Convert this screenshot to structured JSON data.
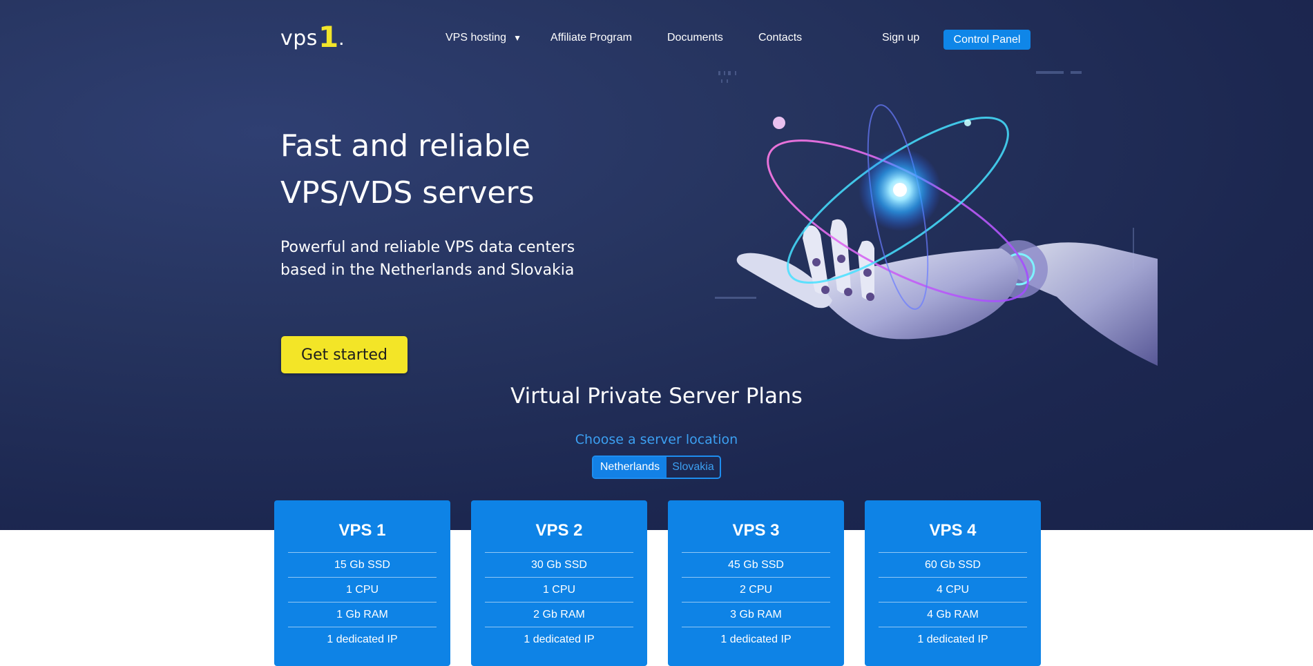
{
  "logo": {
    "text": "vps",
    "number": "1",
    "dot": "."
  },
  "nav": {
    "vps_hosting": "VPS hosting",
    "affiliate": "Affiliate Program",
    "documents": "Documents",
    "contacts": "Contacts",
    "sign_up": "Sign up",
    "control_panel": "Control Panel"
  },
  "hero": {
    "title_line1": "Fast and reliable",
    "title_line2": "VPS/VDS servers",
    "subtitle": "Powerful and reliable VPS data centers based in the Netherlands and Slovakia",
    "cta": "Get started"
  },
  "plans": {
    "title": "Virtual Private Server Plans",
    "location_label": "Choose a server location",
    "locations": [
      "Netherlands",
      "Slovakia"
    ],
    "selected_location": "Netherlands",
    "cards": [
      {
        "name": "VPS 1",
        "specs": [
          "15 Gb SSD",
          "1 CPU",
          "1 Gb RAM",
          "1 dedicated IP"
        ]
      },
      {
        "name": "VPS 2",
        "specs": [
          "30 Gb SSD",
          "1 CPU",
          "2 Gb RAM",
          "1 dedicated IP"
        ]
      },
      {
        "name": "VPS 3",
        "specs": [
          "45 Gb SSD",
          "2 CPU",
          "3 Gb RAM",
          "1 dedicated IP"
        ]
      },
      {
        "name": "VPS 4",
        "specs": [
          "60 Gb SSD",
          "4 CPU",
          "4 Gb RAM",
          "1 dedicated IP"
        ]
      }
    ]
  },
  "colors": {
    "hero_bg": "#1c2750",
    "accent_blue": "#0e83e6",
    "cta_yellow": "#f3e527",
    "logo_yellow": "#f2e52a"
  },
  "icons": {
    "dropdown": "caret-down-icon",
    "illustration": "robot-hand-atom-illustration"
  }
}
